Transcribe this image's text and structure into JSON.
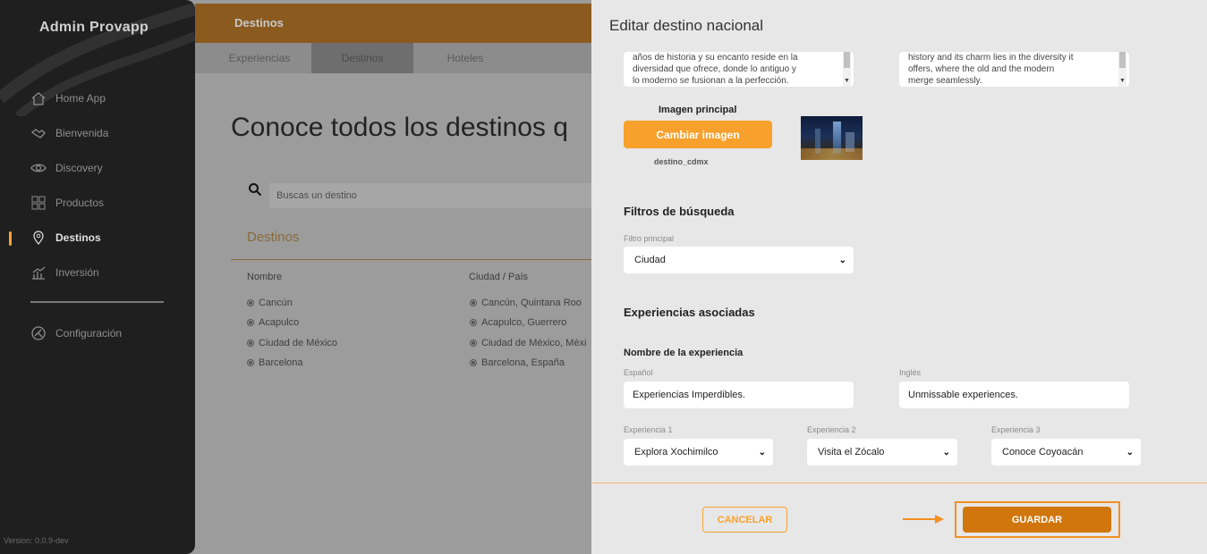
{
  "sidebar": {
    "brand": "Admin Provapp",
    "items": [
      {
        "label": "Home App",
        "icon": "home-icon"
      },
      {
        "label": "Bienvenida",
        "icon": "handshake-icon"
      },
      {
        "label": "Discovery",
        "icon": "eye-icon"
      },
      {
        "label": "Productos",
        "icon": "grid-icon"
      },
      {
        "label": "Destinos",
        "icon": "map-pin-icon",
        "active": true
      },
      {
        "label": "Inversión",
        "icon": "chart-icon"
      }
    ],
    "settings": {
      "label": "Configuración",
      "icon": "settings-icon"
    },
    "version": "Version: 0.0.9-dev"
  },
  "background_page": {
    "topbar_title": "Destinos",
    "tabs": [
      {
        "label": "Experiencias"
      },
      {
        "label": "Destinos",
        "active": true
      },
      {
        "label": "Hoteles"
      }
    ],
    "heading": "Conoce todos los destinos q",
    "search_placeholder": "Buscas un destino",
    "section_label": "Destinos",
    "columns": [
      "Nombre",
      "Ciudad / País"
    ],
    "rows": [
      [
        "Cancún",
        "Cancún, Quintana Roo"
      ],
      [
        "Acapulco",
        "Acapulco, Guerrero"
      ],
      [
        "Ciudad de México",
        "Ciudad de México, Méxi"
      ],
      [
        "Barcelona",
        "Barcelona, España"
      ]
    ]
  },
  "modal": {
    "title": "Editar destino nacional",
    "description_es_lines": [
      "años de historia y su encanto reside en la",
      "diversidad que ofrece, donde lo antiguo y",
      "lo moderno se fusionan a la perfección."
    ],
    "description_en_lines": [
      "history and its charm lies in the diversity it",
      "offers, where the old and the modern",
      "merge seamlessly."
    ],
    "image_label": "Imagen principal",
    "change_image_button": "Cambiar imagen",
    "file_name": "destino_cdmx",
    "filters_title": "Filtros de búsqueda",
    "filter_label": "Filtro principal",
    "filter_value": "Ciudad",
    "experiences_title": "Experiencias asociadas",
    "experience_name_title": "Nombre de la experiencia",
    "spanish_label": "Español",
    "spanish_value": "Experiencias Imperdibles.",
    "english_label": "Inglés",
    "english_value": "Unmissable experiences.",
    "experience_selects": [
      {
        "label": "Experiencia 1",
        "value": "Explora Xochimilco"
      },
      {
        "label": "Experiencia 2",
        "value": "Visita el Zócalo"
      },
      {
        "label": "Experiencia 3",
        "value": "Conoce Coyoacán"
      }
    ],
    "cancel_button": "CANCELAR",
    "save_button": "GUARDAR"
  },
  "colors": {
    "accent": "#f7a12c",
    "save_button": "#d1760c",
    "sidebar_bg": "#1f1f1f",
    "modal_bg": "#e7e7e7"
  }
}
